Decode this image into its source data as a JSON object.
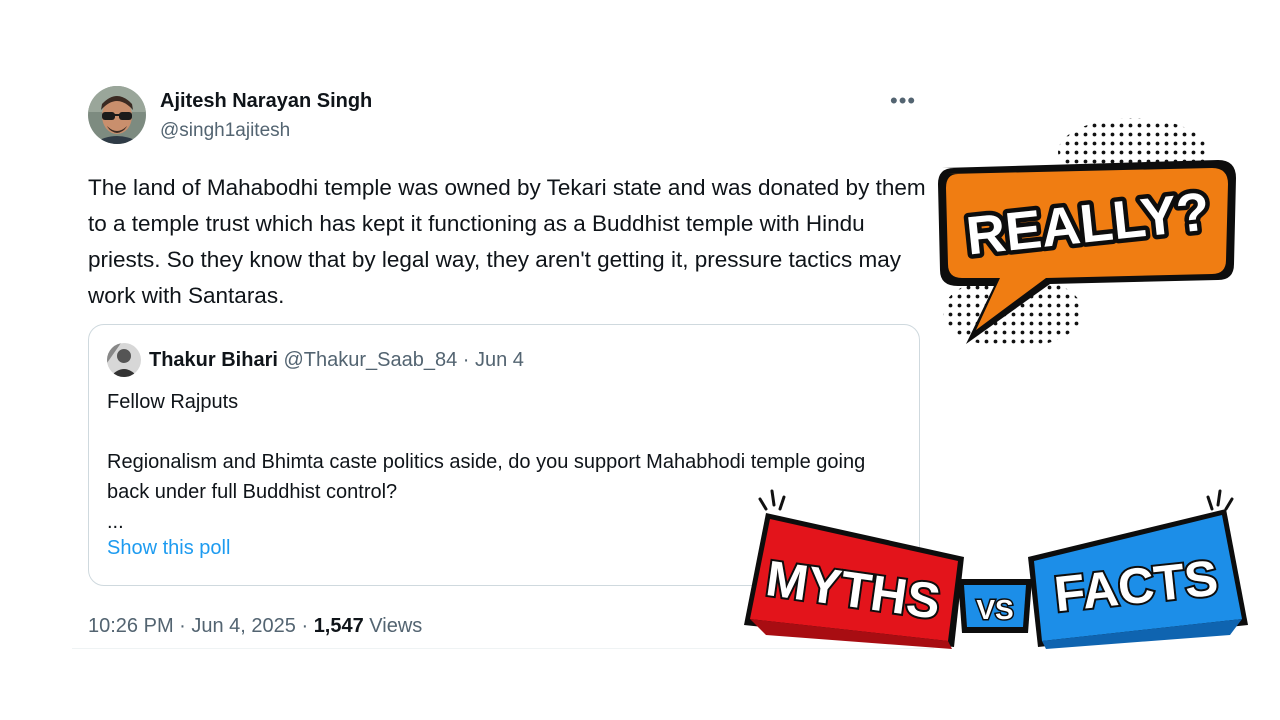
{
  "tweet": {
    "author_name": "Ajitesh Narayan Singh",
    "author_handle": "@singh1ajitesh",
    "more_label": "•••",
    "text": "The land of Mahabodhi temple was owned by Tekari state and was donated by them to a temple trust which has kept it functioning as a Buddhist temple with Hindu priests. So they know that by legal way, they aren't getting it, pressure tactics may work with Santaras.",
    "time": "10:26 PM · Jun 4, 2025 · ",
    "views_count": "1,547",
    "views_label": " Views"
  },
  "quote": {
    "name": "Thakur Bihari",
    "meta": " @Thakur_Saab_84 · Jun 4",
    "body": "Fellow Rajputs\n\nRegionalism and Bhimta caste politics aside, do you support Mahabhodi temple going back under full Buddhist control?\n...",
    "poll_link": "Show this poll"
  },
  "overlays": {
    "really_text": "REALLY?",
    "myths_text": "MYTHS",
    "vs_text": "VS",
    "facts_text": "FACTS"
  },
  "colors": {
    "accent_blue": "#1d9bf0",
    "really_orange": "#f07d12",
    "myths_red": "#e3141b",
    "facts_blue": "#1c8ee8"
  }
}
